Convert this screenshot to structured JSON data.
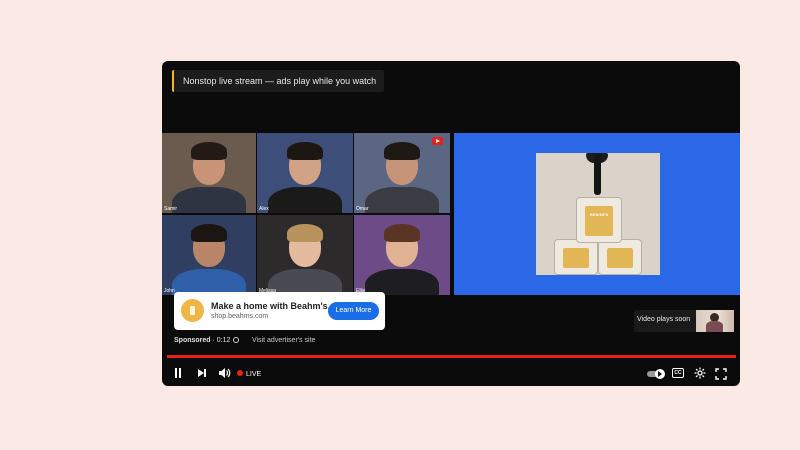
{
  "banner": {
    "text": "Nonstop live stream — ads play while you watch",
    "accent": "#f2b530"
  },
  "participants": [
    {
      "name": "Samir",
      "bg": "#6b5a4e",
      "skin": "#c89377",
      "hair": "#231a16",
      "shirt": "#2f3540"
    },
    {
      "name": "Alex",
      "bg": "#3d4f78",
      "skin": "#d0a286",
      "hair": "#1d1714",
      "shirt": "#1a1a1a"
    },
    {
      "name": "Omar",
      "bg": "#5a6682",
      "skin": "#c59478",
      "hair": "#1f1915",
      "shirt": "#3b3b43"
    },
    {
      "name": "John",
      "bg": "#2f3e61",
      "skin": "#b98568",
      "hair": "#1c1613",
      "shirt": "#2f5fa8"
    },
    {
      "name": "Melissa",
      "bg": "#2d2a2c",
      "skin": "#e4bb9c",
      "hair": "#b8935e",
      "shirt": "#4a4a52"
    },
    {
      "name": "Ellie",
      "bg": "#6d4b86",
      "skin": "#e0b294",
      "hair": "#5a3424",
      "shirt": "#1e1e22"
    }
  ],
  "product": {
    "brand_on_can": "BEAHM'S",
    "panel_color": "#2a68e8"
  },
  "ad": {
    "title": "Make a home with Beahm's.",
    "domain": "shop.beahms.com",
    "cta_label": "Learn More",
    "cta_color": "#1a6de8"
  },
  "sponsored": {
    "label": "Sponsored",
    "time": "0:12",
    "visit_label": "Visit advertiser's site"
  },
  "up_next": {
    "label": "Video plays soon"
  },
  "progress": {
    "fraction": 1.0,
    "color": "#e62117"
  },
  "controls": {
    "live_label": "LIVE",
    "live_color": "#e62117",
    "cc_label": "CC"
  },
  "icons": [
    "pause-icon",
    "next-icon",
    "volume-icon",
    "autoplay-toggle-icon",
    "cc-icon",
    "settings-gear-icon",
    "fullscreen-icon",
    "info-icon"
  ]
}
